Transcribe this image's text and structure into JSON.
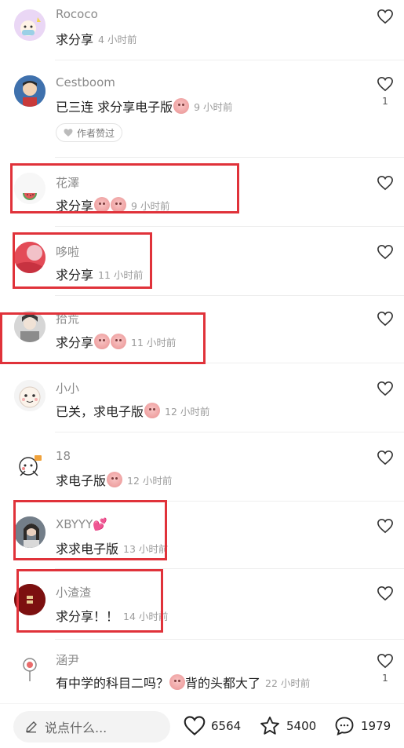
{
  "comments": [
    {
      "name": "Rococo",
      "text": "求分享",
      "time": "4 小时前"
    },
    {
      "name": "Cestboom",
      "text": "已三连 求分享电子版",
      "time": "9 小时前",
      "likes": "1",
      "badge": "作者赞过"
    },
    {
      "name": "花澤",
      "text": "求分享",
      "time": "9 小时前"
    },
    {
      "name": "哆啦",
      "text": "求分享",
      "time": "11 小时前"
    },
    {
      "name": "拾荒",
      "text": "求分享",
      "time": "11 小时前"
    },
    {
      "name": "小小",
      "text": "已关，求电子版",
      "time": "12 小时前"
    },
    {
      "name": "18",
      "text": "求电子版",
      "time": "12 小时前"
    },
    {
      "name": "XBYYY💕",
      "text": "求求电子版",
      "time": "13 小时前"
    },
    {
      "name": "小渣渣",
      "text": "求分享！！",
      "time": "14 小时前"
    },
    {
      "name": "涵尹",
      "text": "有中学的科目二吗？",
      "text2": "背的头都大了",
      "time": "22 小时前",
      "likes": "1"
    }
  ],
  "bottom_bar": {
    "placeholder": "说点什么...",
    "likes": "6564",
    "favorites": "5400",
    "comments": "1979"
  },
  "colors": {
    "highlight_box": "#e0323a",
    "text_primary": "#222222",
    "text_secondary": "#9b9b9b"
  }
}
